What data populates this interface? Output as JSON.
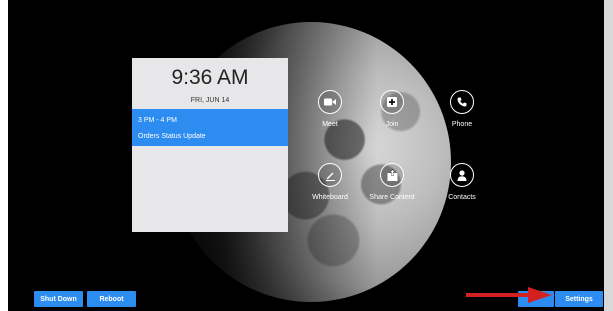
{
  "clock": {
    "time": "9:36 AM",
    "date": "FRI, JUN 14"
  },
  "meeting": {
    "time": "3 PM - 4 PM",
    "title": "Orders Status Update"
  },
  "tiles": [
    {
      "label": "Meet",
      "icon": "video-camera-icon"
    },
    {
      "label": "Join",
      "icon": "plus-box-icon"
    },
    {
      "label": "Phone",
      "icon": "phone-icon"
    },
    {
      "label": "Whiteboard",
      "icon": "pen-icon"
    },
    {
      "label": "Share Content",
      "icon": "share-upload-icon"
    },
    {
      "label": "Contacts",
      "icon": "person-icon"
    }
  ],
  "buttons": {
    "shut_down": "Shut Down",
    "reboot": "Reboot",
    "settings": "Settings"
  },
  "colors": {
    "accent": "#2d8cf0",
    "annotation_arrow": "#d42020",
    "background": "#000000"
  }
}
